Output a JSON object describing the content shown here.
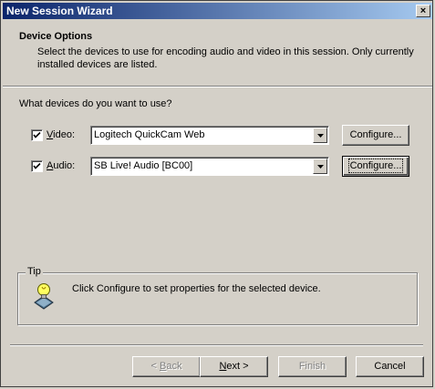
{
  "window": {
    "title": "New Session Wizard",
    "close_glyph": "×"
  },
  "header": {
    "title": "Device Options",
    "description": "Select the devices to use for encoding audio and video in this session. Only currently installed devices are listed."
  },
  "question": "What devices do you want to use?",
  "devices": {
    "video": {
      "label_pre": "",
      "label_mnemonic": "V",
      "label_post": "ideo:",
      "checked": true,
      "selected": "Logitech QuickCam Web",
      "configure_label": "Configure..."
    },
    "audio": {
      "label_pre": "",
      "label_mnemonic": "A",
      "label_post": "udio:",
      "checked": true,
      "selected": "SB Live! Audio [BC00]",
      "configure_label": "Configure..."
    }
  },
  "tip": {
    "legend": "Tip",
    "text": "Click Configure to set properties for the selected device.",
    "icon": "lightbulb-icon"
  },
  "buttons": {
    "back": {
      "pre": "< ",
      "mnemonic": "B",
      "post": "ack"
    },
    "next": {
      "pre": "",
      "mnemonic": "N",
      "post": "ext >"
    },
    "finish": "Finish",
    "cancel": "Cancel"
  },
  "colors": {
    "title_bar_start": "#0a246a",
    "title_bar_end": "#a6caf0",
    "face": "#d4d0c8"
  }
}
